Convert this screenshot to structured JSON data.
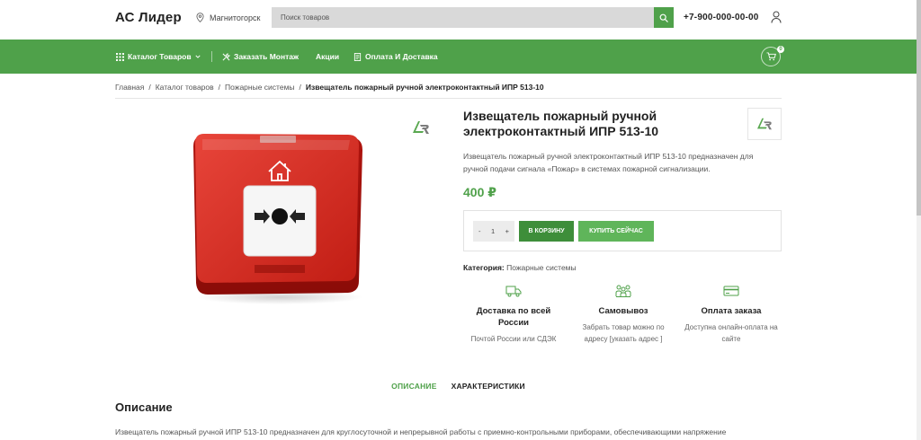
{
  "header": {
    "logo": "АС Лидер",
    "city": "Магнитогорск",
    "search_placeholder": "Поиск товаров",
    "phone": "+7-900-000-00-00"
  },
  "nav": {
    "items": [
      {
        "label": "Каталог Товаров",
        "icon": "grid-icon",
        "has_dropdown": true
      },
      {
        "label": "Заказать Монтаж",
        "icon": "tools-icon"
      },
      {
        "label": "Акции"
      },
      {
        "label": "Оплата И Доставка",
        "icon": "document-icon"
      }
    ],
    "cart_count": "0"
  },
  "breadcrumb": {
    "items": [
      "Главная",
      "Каталог товаров",
      "Пожарные системы"
    ],
    "current": "Извещатель пожарный ручной электроконтактный ИПР 513-10"
  },
  "product": {
    "title": "Извещатель пожарный ручной электроконтактный ИПР 513-10",
    "description": "Извещатель пожарный ручной электроконтактный ИПР 513-10 предназначен для ручной подачи сигнала «Пожар» в системах пожарной сигнализации.",
    "price": "400 ₽",
    "qty": "1",
    "qty_minus": "-",
    "qty_plus": "+",
    "add_to_cart": "В КОРЗИНУ",
    "buy_now": "КУПИТЬ СЕЙЧАС",
    "category_label": "Категория:",
    "category_value": "Пожарные системы"
  },
  "features": [
    {
      "icon": "truck-icon",
      "title": "Доставка по всей России",
      "text": "Почтой России или СДЭК"
    },
    {
      "icon": "people-icon",
      "title": "Самовывоз",
      "text": "Забрать товар можно по адресу [указать адрес ]"
    },
    {
      "icon": "card-icon",
      "title": "Оплата заказа",
      "text": "Доступна онлайн-оплата на сайте"
    }
  ],
  "tabs": [
    "ОПИСАНИЕ",
    "ХАРАКТЕРИСТИКИ"
  ],
  "description_section": {
    "title": "Описание",
    "text": "Извещатель пожарный ручной ИПР 513-10 предназначен для круглосуточной и непрерывной работы с приемно-контрольными приборами, обеспечивающими напряжение"
  },
  "colors": {
    "accent": "#4fa14a",
    "accent_dark": "#3e8e3a",
    "accent_light": "#5fb55a"
  }
}
